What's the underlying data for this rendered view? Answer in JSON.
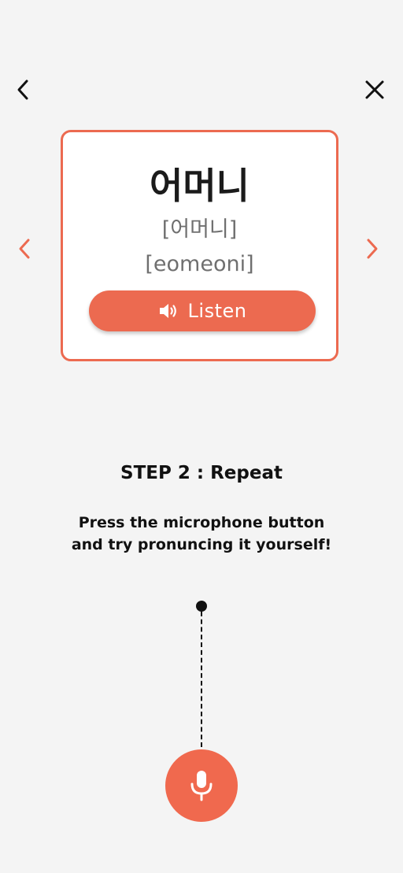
{
  "nav": {
    "back_icon": "chevron-left-icon",
    "close_icon": "close-icon",
    "prev_icon": "chevron-left-icon",
    "next_icon": "chevron-right-icon"
  },
  "card": {
    "word": "어머니",
    "pronunciation": "[어머니]",
    "romanization": "[eomeoni]",
    "listen_label": "Listen",
    "listen_icon": "speaker-icon"
  },
  "step": {
    "title": "STEP 2 : Repeat",
    "instruction_line1": "Press the microphone button",
    "instruction_line2": "and try pronuncing it yourself!"
  },
  "mic": {
    "icon": "microphone-icon"
  },
  "colors": {
    "accent": "#ec6a50",
    "background": "#f4f4f4",
    "text": "#111111",
    "muted": "#6f6f6f"
  }
}
